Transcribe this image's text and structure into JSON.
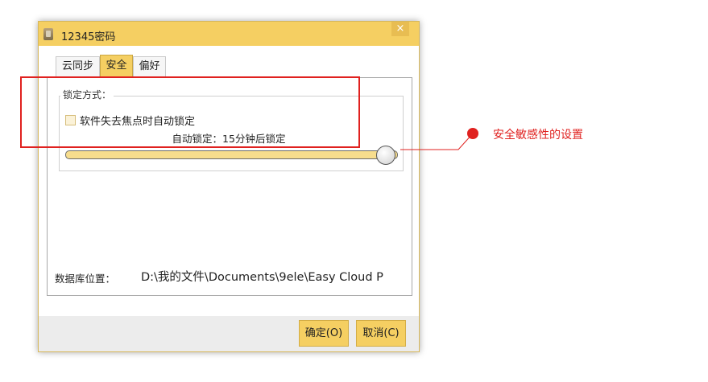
{
  "window": {
    "title": "12345密码",
    "close_label": "×"
  },
  "tabs": [
    {
      "label": "云同步",
      "active": false
    },
    {
      "label": "安全",
      "active": true
    },
    {
      "label": "偏好",
      "active": false
    }
  ],
  "lock": {
    "group_title": "锁定方式：",
    "checkbox_label": "软件失去焦点时自动锁定",
    "checkbox_checked": false,
    "slider_text": "自动锁定：15分钟后锁定",
    "slider_fraction": 0.97
  },
  "database": {
    "label": "数据库位置：",
    "path": "D:\\我的文件\\Documents\\9ele\\Easy Cloud P"
  },
  "buttons": {
    "ok": "确定(O)",
    "cancel": "取消(C)"
  },
  "annotation": {
    "text": "安全敏感性的设置",
    "color": "#e0211f"
  },
  "colors": {
    "accent": "#f5cf62",
    "highlight": "#e0211f"
  },
  "icons": {
    "app": "password-manager-icon",
    "close": "close-icon"
  }
}
